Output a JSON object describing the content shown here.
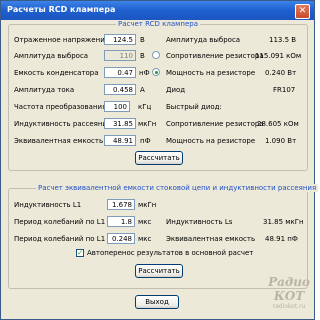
{
  "window": {
    "title": "Расчеты RCD клампера",
    "close_glyph": "✕"
  },
  "group1": {
    "legend": "Расчет RCD клампера",
    "rows": [
      {
        "label": "Отраженное напряжение",
        "value": "124.5",
        "unit": "В",
        "r_label": "Амплитуда выброса",
        "r_value": "113.5 В"
      },
      {
        "label": "Амплитуда выброса",
        "value": "110",
        "unit": "В",
        "r_label": "Сопротивление резистора",
        "r_value": "115.091 кОм"
      },
      {
        "label": "Емкость конденсатора",
        "value": "0.47",
        "unit": "нФ",
        "r_label": "Мощность на резисторе",
        "r_value": "0.240 Вт"
      },
      {
        "label": "Амплитуда тока",
        "value": "0.458",
        "unit": "А",
        "r_label": "Диод",
        "r_value": "FR107"
      },
      {
        "label": "Частота преобразования",
        "value": "100",
        "unit": "кГц",
        "r_label": "Быстрый диод:",
        "r_value": ""
      },
      {
        "label": "Индуктивность рассеяния",
        "value": "31.85",
        "unit": "мкГн",
        "r_label": "Сопротивление резистора",
        "r_value": "28.605 кОм"
      },
      {
        "label": "Эквивалентная емкость",
        "value": "48.91",
        "unit": "пФ",
        "r_label": "Мощность на резисторе",
        "r_value": "1.090 Вт"
      }
    ],
    "calc_button": "Рассчитать"
  },
  "group2": {
    "legend": "Расчет эквивалентной емкости стоковой цепи и индуктивности рассеяния",
    "rows": [
      {
        "label": "Индуктивность L1",
        "value": "1.678",
        "unit": "мкГн",
        "r_label": "",
        "r_value": ""
      },
      {
        "label": "Период колебаний по L1",
        "value": "1.8",
        "unit": "мкс",
        "r_label": "Индуктивность Ls",
        "r_value": "31.85 мкГн"
      },
      {
        "label": "Период колебаний по L1",
        "value": "0.248",
        "unit": "мкс",
        "r_label": "Эквивалентная емкость",
        "r_value": "48.91 пФ"
      }
    ],
    "checkbox_label": "Автоперенос результатов в основной расчет",
    "checkbox_checked": true,
    "checkbox_mark": "✓",
    "calc_button": "Рассчитать"
  },
  "exit_button": "Выход",
  "watermark": {
    "line1": "Радио КОТ",
    "line2": "radiokot.ru"
  },
  "colors": {
    "title_bar": "#1f5fcf",
    "legend_text": "#2050c8",
    "window_bg": "#ece9d8"
  }
}
